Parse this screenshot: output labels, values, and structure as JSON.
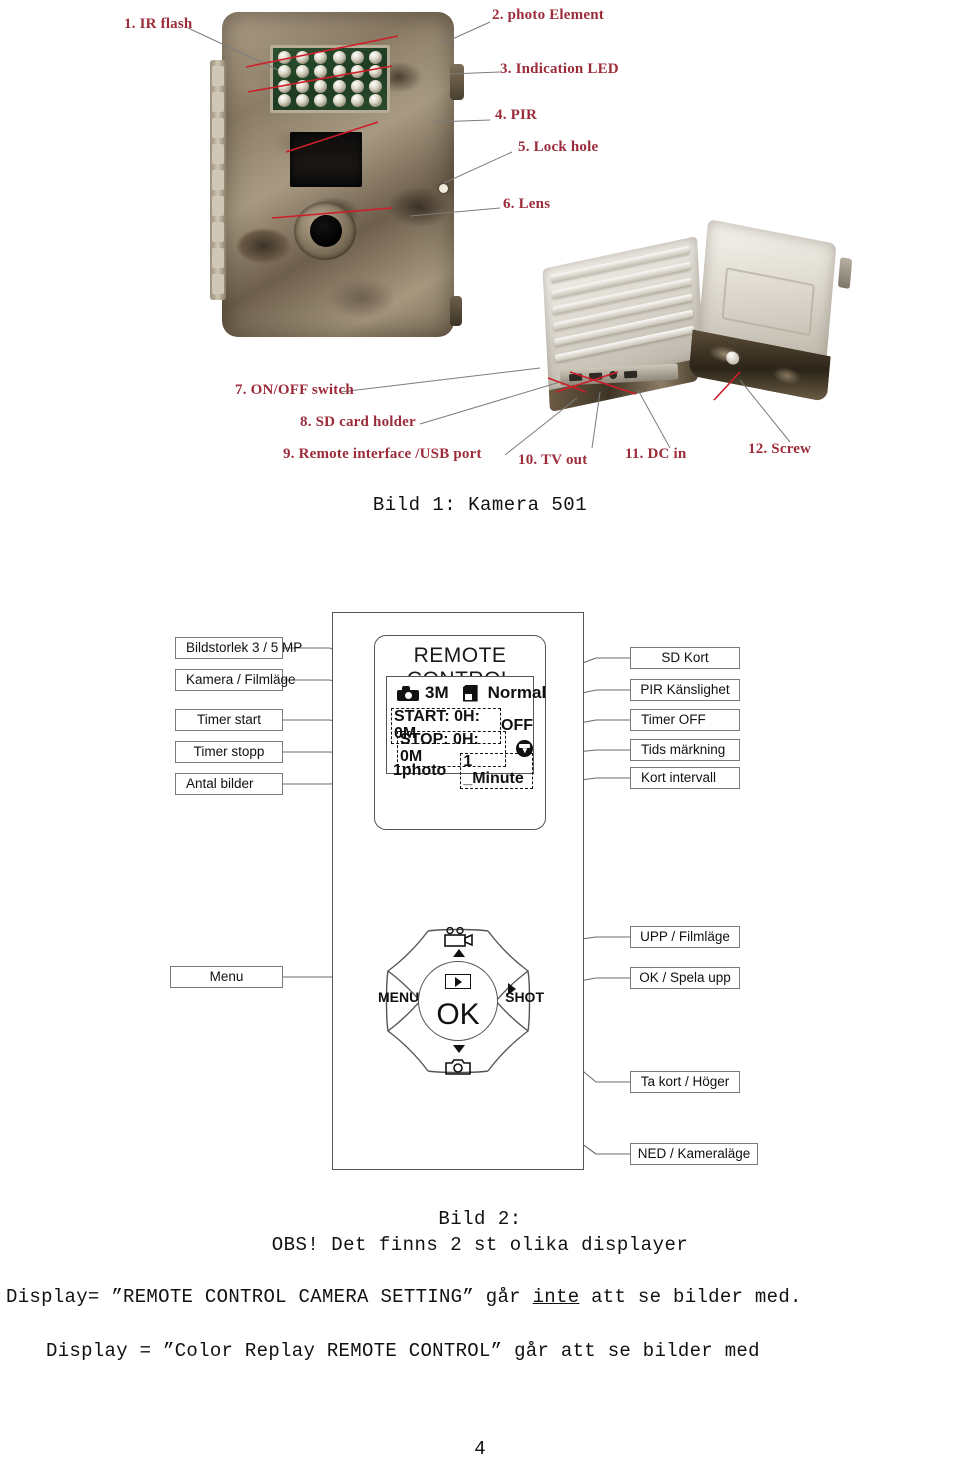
{
  "figure1": {
    "caption": "Bild 1: Kamera 501",
    "labels": [
      {
        "id": "ir-flash",
        "text": "1. IR flash"
      },
      {
        "id": "photo-element",
        "text": "2. photo Element"
      },
      {
        "id": "indication-led",
        "text": "3. Indication LED"
      },
      {
        "id": "pir",
        "text": "4. PIR"
      },
      {
        "id": "lock-hole",
        "text": "5. Lock hole"
      },
      {
        "id": "lens",
        "text": "6. Lens"
      },
      {
        "id": "onoff-switch",
        "text": "7. ON/OFF  switch"
      },
      {
        "id": "sd-card-holder",
        "text": "8. SD card holder"
      },
      {
        "id": "remote-usb",
        "text": "9. Remote interface /USB port"
      },
      {
        "id": "tv-out",
        "text": "10. TV out"
      },
      {
        "id": "dc-in",
        "text": "11. DC in"
      },
      {
        "id": "screw",
        "text": "12. Screw"
      }
    ],
    "leader_color": "#b02a37"
  },
  "figure2": {
    "caption_line1": "Bild 2:",
    "caption_line2": "OBS! Det finns 2 st olika displayer",
    "remote": {
      "title": "REMOTE CONTROL",
      "lcd": {
        "resolution": "3M",
        "sd_status": "Normal",
        "timer_start": "START: 0H: 0M",
        "timer_off": "OFF",
        "timer_stop": "STOP: 0H: 0M",
        "photo_count": "1photo",
        "interval": "1 _Minute"
      },
      "dpad": {
        "ok": "OK",
        "menu": "MENU",
        "shot": "SHOT"
      }
    },
    "callouts_left": [
      {
        "id": "bildstorlek",
        "text": "Bildstorlek 3 / 5 MP"
      },
      {
        "id": "kamera-filmlage",
        "text": "Kamera / Filmläge"
      },
      {
        "id": "timer-start",
        "text": "Timer start"
      },
      {
        "id": "timer-stopp",
        "text": "Timer stopp"
      },
      {
        "id": "antal-bilder",
        "text": "Antal bilder"
      },
      {
        "id": "menu",
        "text": "Menu"
      }
    ],
    "callouts_right": [
      {
        "id": "sd-kort",
        "text": "SD Kort"
      },
      {
        "id": "pir-kanslighet",
        "text": "PIR Känslighet"
      },
      {
        "id": "timer-off",
        "text": "Timer OFF"
      },
      {
        "id": "tids-markning",
        "text": "Tids märkning"
      },
      {
        "id": "kort-intervall",
        "text": "Kort intervall"
      },
      {
        "id": "upp-filmlage",
        "text": "UPP / Filmläge"
      },
      {
        "id": "ok-spela-upp",
        "text": "OK / Spela upp"
      },
      {
        "id": "ta-kort-hoger",
        "text": "Ta kort / Höger"
      },
      {
        "id": "ned-kameralage",
        "text": "NED / Kameraläge"
      }
    ]
  },
  "body": {
    "line1_a": "Display= ”REMOTE CONTROL CAMERA SETTING” går ",
    "line1_u": "inte",
    "line1_b": " att se bilder med.",
    "line2": "Display = ”Color Replay REMOTE CONTROL” går att se bilder med"
  },
  "page_number": "4"
}
